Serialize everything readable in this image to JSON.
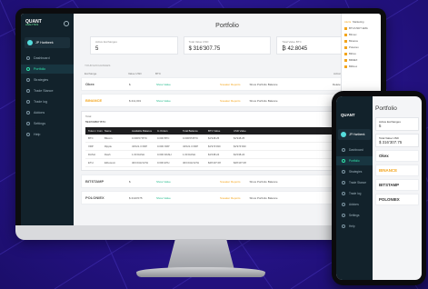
{
  "colors": {
    "accent": "#2fe3a7",
    "sidebar": "#12222b",
    "binance": "#f3a51c",
    "background": "#2a1a8c"
  },
  "app": {
    "logo_line1": "QUANT",
    "logo_line2": "ANALYTICS",
    "account_name": "JP Hartbeek"
  },
  "nav": [
    {
      "label": "Dashboard",
      "icon": "dashboard-icon"
    },
    {
      "label": "Portfolio",
      "icon": "portfolio-icon",
      "active": true
    },
    {
      "label": "Strategies",
      "icon": "strategies-icon"
    },
    {
      "label": "Trade Stance",
      "icon": "trade-stance-icon"
    },
    {
      "label": "Trade log",
      "icon": "trade-log-icon"
    },
    {
      "label": "Addons",
      "icon": "addons-icon"
    },
    {
      "label": "Settings",
      "icon": "settings-icon"
    },
    {
      "label": "Help",
      "icon": "help-icon"
    }
  ],
  "main": {
    "title": "Portfolio",
    "stats": [
      {
        "label": "Active Exchanges",
        "value": "5"
      },
      {
        "label": "Total Value USD",
        "value": "$ 316'307.75"
      },
      {
        "label": "Total Value BTC",
        "value": "₿ 42.8045"
      }
    ],
    "section_title": "YOUR EXCHANGES",
    "section_actions": [
      "Import file",
      "Sync all"
    ],
    "table_headers": [
      "Exchange",
      "Value USD",
      "BTC",
      "",
      "Actions"
    ],
    "exchanges": [
      {
        "name": "Okex",
        "value": "$",
        "action1": "Show Value",
        "action2": "Sneaker Reports",
        "action3": "Show Portfolio Balance",
        "action4": "Delete"
      },
      {
        "name": "BINANCE",
        "value": "$ 211,001",
        "action1": "Show Value",
        "action2": "Sneaker Reports",
        "action3": "Show Portfolio Balance",
        "action4": "Delete"
      }
    ],
    "panel": {
      "title": "Total",
      "total": "5943'00807 BTC",
      "link": "Import file",
      "bal_headers": [
        "Token / Coin",
        "Name",
        "Available Balance",
        "In Orders",
        "Total Balance",
        "BTC Value",
        "USD Value"
      ],
      "rows": [
        [
          "BTC",
          "Bitcoin",
          "0.000'07 BTC",
          "0.000 BTC",
          "0.000'05 BTC",
          "$1'948.25",
          "$1'948.25"
        ],
        [
          "XRP",
          "Ripple",
          "43'021.3 XRP",
          "0.000 XRP",
          "43'021.3 XRP",
          "$1'974'030",
          "$1'974'030"
        ],
        [
          "DASH",
          "Dash",
          "1.00 DASH",
          "0.000 DASH",
          "1.00 DASH",
          "$1'038.24",
          "$1'038.24"
        ],
        [
          "ETH",
          "Ethereum",
          "403.0412 ETH",
          "0.000 ETH",
          "403.0412 ETH",
          "$49'107.08",
          "$49'107.08"
        ]
      ]
    },
    "exchanges2": [
      {
        "name": "BITSTAMP",
        "value": "$",
        "action1": "Show Value",
        "action2": "Sneaker Reports",
        "action3": "Show Portfolio Balance",
        "action4": "Delete"
      },
      {
        "name": "POLONIEX",
        "value": "$ 2110'075",
        "action1": "Show Value",
        "action2": "Sneaker Reports",
        "action3": "Show Portfolio Balance",
        "action4": "Delete"
      }
    ]
  },
  "right_panel": {
    "tabs": [
      "Alerts",
      "Marketing"
    ],
    "items": [
      "BTC/USDT EMA",
      "Bitmex",
      "Binance",
      "Poloniex",
      "Bittrex",
      "BitMEX",
      "Bitfinex"
    ]
  },
  "phone": {
    "title": "Portfolio",
    "stats": [
      {
        "label": "Active Exchanges",
        "value": "5"
      },
      {
        "label": "Total Value USD",
        "value": "$ 316'307.75"
      }
    ],
    "exchanges": [
      "Okex",
      "BINANCE",
      "BITSTAMP",
      "POLONIEX"
    ]
  }
}
